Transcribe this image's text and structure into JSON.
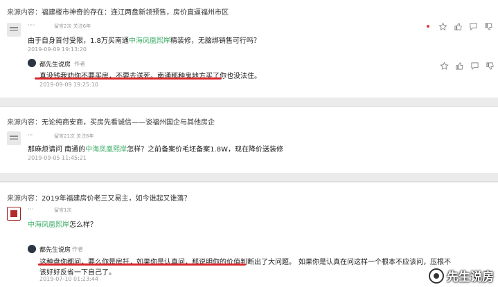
{
  "source_label": "来源内容：",
  "comments": [
    {
      "source_title": "福建楼市神奇的存在：连江两盘新领预售，房价直逼福州市区",
      "username": "· ·· ·",
      "meta": "留言2次  关注6年",
      "text_a": "由于自身首付受限，1.8万买南通",
      "text_green": "中海凤凰熙岸",
      "text_b": "精装修，无脑绑销售可行吗？",
      "time": "2019-09-09 19:13:20",
      "reply": {
        "author": "都先生说房",
        "tag": "作者",
        "text": "真没钱我劝你不要买房，不要去送死。南通那种鬼地方买了你也没法住。",
        "time": "2019-09-09 19:25:10"
      }
    },
    {
      "source_title": "无论纯商安商，买房先看诚信——谈福州国企与其他房企",
      "username": "· ··",
      "meta": "留言21次  关注6年",
      "text_a": "那麻烦请问 南通的",
      "text_green": "中海凤凰熙岸",
      "text_b": "怎样？之前备案价毛坯备案1.8W，现在降价送装修",
      "time": "2019-09-05 11:45:21"
    },
    {
      "source_title": "2019年福建房价老三又易主，如今谁起又谁落？",
      "username": "· · ·",
      "meta": "留言1次",
      "text_green": "中海凤凰熙岸",
      "text_b": "怎么样？",
      "reply": {
        "author": "都先生说房",
        "tag": "作者",
        "text_1": "这种盘你都问，要么你是房托，如果你是认真问，那说明你的价值判断出了大问题。",
        "text_2": "如果你是认真在问这样一个根本不应该问，压根不",
        "text_3": "该好好反省一下自己了。",
        "time": "2019-07-10 01:23:44"
      }
    }
  ],
  "watermark": "先生说房",
  "icons": [
    "star-icon",
    "thumb-up-icon",
    "comment-icon",
    "thumb-down-icon"
  ]
}
